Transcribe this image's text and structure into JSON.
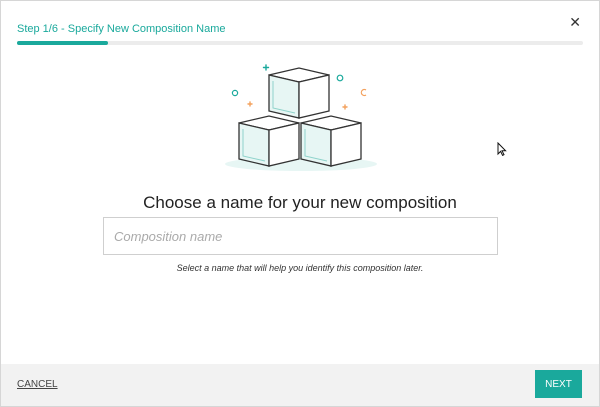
{
  "dialog": {
    "step_label": "Step 1/6 - Specify New Composition Name",
    "progress": 0.16,
    "close_icon": "close-icon",
    "title": "Choose a name for your new composition",
    "input": {
      "value": "",
      "placeholder": "Composition name"
    },
    "hint": "Select a name that will help you identify this composition later.",
    "cancel_label": "CANCEL",
    "next_label": "NEXT"
  },
  "colors": {
    "accent": "#1aa99c",
    "orange": "#f3a15d",
    "outline": "#333333",
    "cube_fill": "#e7f6f4"
  }
}
